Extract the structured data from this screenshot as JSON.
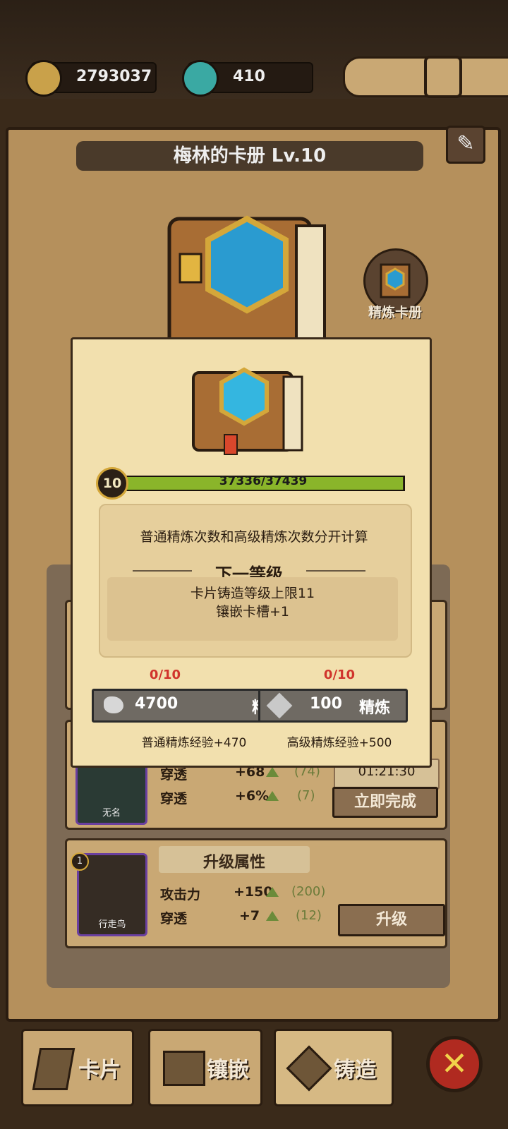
{
  "resources": {
    "gold": "2793037",
    "gems": "410"
  },
  "book": {
    "title": "梅林的卡册 Lv.10",
    "refine_label": "精炼卡册"
  },
  "popup": {
    "level": "10",
    "xp_text": "37336/37439",
    "xp_fraction": 0.997,
    "note": "普通精炼次数和高级精炼次数分开计算",
    "next_level_title": "下一等级",
    "next_level_lines": [
      "卡片铸造等级上限11",
      "镶嵌卡槽+1"
    ],
    "normal": {
      "count": "0/10",
      "cost": "4700",
      "label": "精炼",
      "exp": "普通精炼经验+470"
    },
    "advanced": {
      "count": "0/10",
      "cost": "100",
      "label": "精炼",
      "exp": "高级精炼经验+500"
    }
  },
  "cards": [
    {
      "badge": "",
      "name": "无名",
      "stats": [
        {
          "name": "穿透",
          "bonus": "+68",
          "next": "(74)"
        },
        {
          "name": "穿透",
          "bonus": "+6%",
          "next": "(7)"
        }
      ],
      "timer": "01:21:30",
      "action": "立即完成"
    },
    {
      "badge": "1",
      "name": "行走鸟",
      "section_title": "升级属性",
      "stats": [
        {
          "name": "攻击力",
          "bonus": "+150",
          "next": "(200)"
        },
        {
          "name": "穿透",
          "bonus": "+7",
          "next": "(12)"
        }
      ],
      "action": "升级"
    }
  ],
  "tabs": {
    "cards": "卡片",
    "inlay": "镶嵌",
    "forge": "铸造"
  },
  "colors": {
    "xp_fill": "#8ab52a",
    "counter_red": "#d0342c",
    "close_red": "#b02a20"
  }
}
